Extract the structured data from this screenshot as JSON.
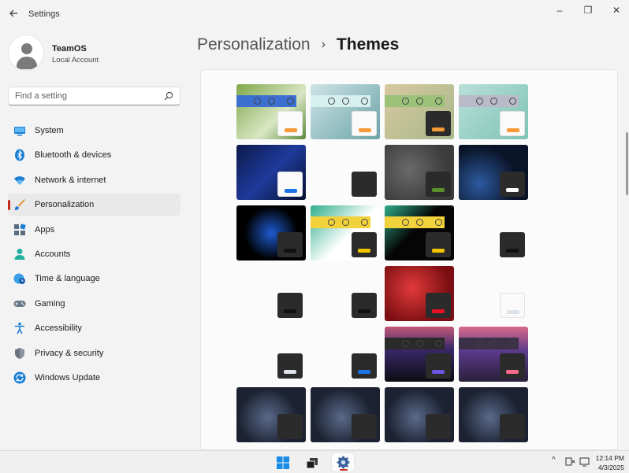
{
  "window": {
    "title": "Settings",
    "controls": {
      "minimize": "–",
      "maximize": "❐",
      "close": "✕"
    }
  },
  "account": {
    "name": "TeamOS",
    "type": "Local Account"
  },
  "search": {
    "placeholder": "Find a setting"
  },
  "sidebar": {
    "items": [
      {
        "id": "system",
        "label": "System",
        "icon": "monitor-icon",
        "active": false
      },
      {
        "id": "bluetooth",
        "label": "Bluetooth & devices",
        "icon": "bluetooth-icon",
        "active": false
      },
      {
        "id": "network",
        "label": "Network & internet",
        "icon": "wifi-icon",
        "active": false
      },
      {
        "id": "personalization",
        "label": "Personalization",
        "icon": "brush-icon",
        "active": true
      },
      {
        "id": "apps",
        "label": "Apps",
        "icon": "apps-icon",
        "active": false
      },
      {
        "id": "accounts",
        "label": "Accounts",
        "icon": "person-icon",
        "active": false
      },
      {
        "id": "time",
        "label": "Time & language",
        "icon": "globe-clock-icon",
        "active": false
      },
      {
        "id": "gaming",
        "label": "Gaming",
        "icon": "gamepad-icon",
        "active": false
      },
      {
        "id": "accessibility",
        "label": "Accessibility",
        "icon": "accessibility-icon",
        "active": false
      },
      {
        "id": "privacy",
        "label": "Privacy & security",
        "icon": "shield-icon",
        "active": false
      },
      {
        "id": "update",
        "label": "Windows Update",
        "icon": "update-icon",
        "active": false
      }
    ]
  },
  "header": {
    "parent": "Personalization",
    "separator": "›",
    "current": "Themes"
  },
  "themes": [
    {
      "bg": "linear-gradient(135deg,#7fa84a,#d9e6c4 60%,#5a8a3a)",
      "accent": "#f59a35",
      "window": "light",
      "titlebar": "#3b6fd0"
    },
    {
      "bg": "linear-gradient(135deg,#cfe4e6,#6aa3a8)",
      "accent": "#f59a35",
      "window": "light",
      "titlebar": "#d6f0f0"
    },
    {
      "bg": "linear-gradient(135deg,#d8c8a0,#a8b88a)",
      "accent": "#f59a35",
      "window": "dark",
      "titlebar": "#9cc27a"
    },
    {
      "bg": "linear-gradient(135deg,#b9e0d8,#7ec2b6)",
      "accent": "#f59a35",
      "window": "light",
      "titlebar": "#b9b9c8"
    },
    {
      "bg": "linear-gradient(135deg,#0b1a4a,#1f3a9a 50%,#081030)",
      "accent": "#1a73e8",
      "window": "light",
      "titlebar": ""
    },
    {
      "bg": "#fbfbfb",
      "accent": "#2b2b2b",
      "window": "dark",
      "titlebar": ""
    },
    {
      "bg": "radial-gradient(circle at 35% 45%,#6a6a6a,#3c3c3c 70%)",
      "accent": "#5b8f2a",
      "window": "dark",
      "titlebar": ""
    },
    {
      "bg": "radial-gradient(circle at 30% 70%,#2c5aa0,#0a1428 60%)",
      "accent": "#ffffff",
      "window": "dark",
      "titlebar": ""
    },
    {
      "bg": "radial-gradient(circle at 50% 50%,#1e5bd0,#000 60%)",
      "accent": "#111111",
      "window": "dark",
      "titlebar": ""
    },
    {
      "bg": "linear-gradient(135deg,#2fae8a,#fff 55%)",
      "accent": "#f2c400",
      "window": "dark",
      "titlebar": "#f2d23a"
    },
    {
      "bg": "linear-gradient(135deg,#2fae8a,#050505 45%)",
      "accent": "#f2c400",
      "window": "dark",
      "titlebar": "#f2d23a"
    },
    {
      "bg": "#fbfbfb",
      "accent": "#111111",
      "window": "dark",
      "titlebar": ""
    },
    {
      "bg": "#fbfbfb",
      "accent": "#111111",
      "window": "dark",
      "titlebar": ""
    },
    {
      "bg": "#fbfbfb",
      "accent": "#111111",
      "window": "dark",
      "titlebar": ""
    },
    {
      "bg": "radial-gradient(circle at 40% 40%,#e23a3a,#7a0e12 70%)",
      "accent": "#e81123",
      "window": "dark",
      "titlebar": ""
    },
    {
      "bg": "#fbfbfb",
      "accent": "#dde3ea",
      "window": "light",
      "titlebar": ""
    },
    {
      "bg": "#fbfbfb",
      "accent": "#dfe3ea",
      "window": "dark",
      "titlebar": ""
    },
    {
      "bg": "#fbfbfb",
      "accent": "#1a73e8",
      "window": "dark",
      "titlebar": ""
    },
    {
      "bg": "linear-gradient(180deg,#c4587a,#3a2a6a 40%,#0c0c14)",
      "accent": "#6a56e0",
      "window": "dark",
      "titlebar": "#2a2a2a"
    },
    {
      "bg": "linear-gradient(180deg,#d86a8a,#5a3a8a 45%,#2a1f3a)",
      "accent": "#f56a8a",
      "window": "dark",
      "titlebar": "#3a3048"
    },
    {
      "bg": "radial-gradient(circle at 45% 55%,#5a6a8a,#1c2232 60%)",
      "accent": "#2b2b2b",
      "window": "dark",
      "titlebar": ""
    },
    {
      "bg": "radial-gradient(circle at 45% 55%,#5a6a8a,#1c2232 60%)",
      "accent": "#2b2b2b",
      "window": "dark",
      "titlebar": ""
    },
    {
      "bg": "radial-gradient(circle at 45% 55%,#5a6a8a,#1c2232 60%)",
      "accent": "#2b2b2b",
      "window": "dark",
      "titlebar": ""
    },
    {
      "bg": "radial-gradient(circle at 45% 55%,#5a6a8a,#1c2232 60%)",
      "accent": "#2b2b2b",
      "window": "dark",
      "titlebar": ""
    }
  ],
  "taskbar": {
    "apps": [
      {
        "name": "start-button",
        "icon": "windows-logo-icon",
        "active": false
      },
      {
        "name": "task-view-button",
        "icon": "task-view-icon",
        "active": false
      },
      {
        "name": "settings-app-button",
        "icon": "gear-icon",
        "active": true
      }
    ],
    "tray": {
      "chevron": "^"
    },
    "clock": {
      "time": "12:14 PM",
      "date": "4/3/2025"
    }
  },
  "colors": {
    "accent_red": "#c42b1c",
    "nav_active_bg": "#e9e9e9"
  }
}
